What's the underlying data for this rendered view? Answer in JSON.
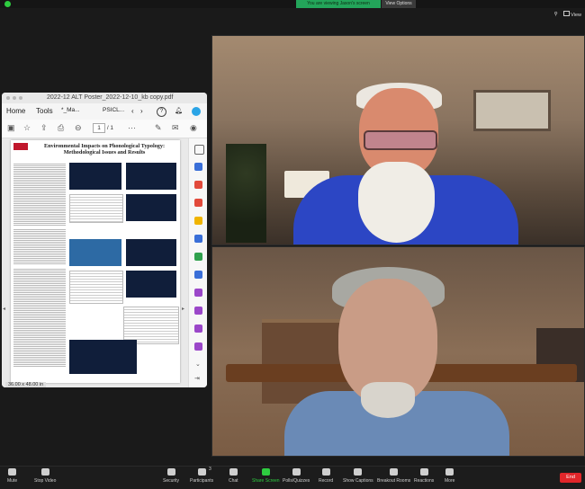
{
  "top": {
    "banner": "You are viewing Jason's screen",
    "view_options": "View Options",
    "view_label": "View"
  },
  "pdf": {
    "title": "2022-12 ALT Poster_2022-12-10_kb copy.pdf",
    "nav": {
      "home": "Home",
      "tools": "Tools",
      "tab1": "*_Ma...",
      "tab2": "PSICL..."
    },
    "page_current": "1",
    "page_total": "/ 1",
    "size_label": "36.00 x 48.00 in"
  },
  "poster": {
    "title_line1": "Environmental Impacts on Phonological Typology:",
    "title_line2": "Methodological Issues and Results"
  },
  "toolbar": {
    "mute": "Mute",
    "stop_video": "Stop Video",
    "security": "Security",
    "participants": "Participants",
    "participants_count": "3",
    "chat": "Chat",
    "share_screen": "Share Screen",
    "polls": "Polls/Quizzes",
    "record": "Record",
    "captions": "Show Captions",
    "breakout": "Breakout Rooms",
    "reactions": "Reactions",
    "more": "More",
    "end": "End"
  },
  "colors": {
    "share_green": "#2ecc40",
    "end_red": "#e0262a",
    "banner_green": "#23a55a"
  }
}
